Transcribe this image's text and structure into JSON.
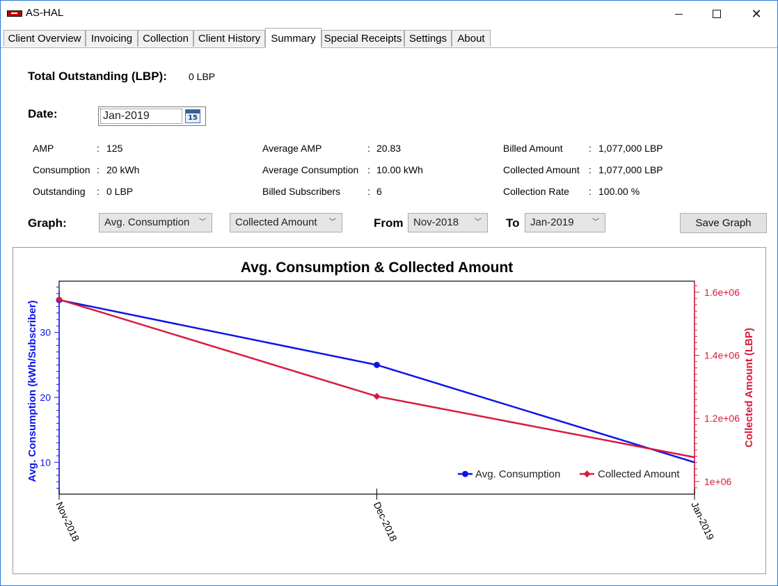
{
  "window": {
    "title": "AS-HAL"
  },
  "tabs": [
    {
      "label": "Client Overview"
    },
    {
      "label": "Invoicing"
    },
    {
      "label": "Collection"
    },
    {
      "label": "Client History"
    },
    {
      "label": "Summary"
    },
    {
      "label": "Special Receipts"
    },
    {
      "label": "Settings"
    },
    {
      "label": "About"
    }
  ],
  "summary": {
    "total_outstanding_label": "Total Outstanding (LBP):",
    "total_outstanding_value": "0 LBP",
    "date_label": "Date:",
    "date_value": "Jan-2019",
    "date_icon_text": "15",
    "stats": {
      "col1": [
        {
          "label": "AMP",
          "sep": ":",
          "value": "125"
        },
        {
          "label": "Consumption",
          "sep": ":",
          "value": "20 kWh"
        },
        {
          "label": "Outstanding",
          "sep": ":",
          "value": "0 LBP"
        }
      ],
      "col2": [
        {
          "label": "Average AMP",
          "sep": ":",
          "value": "20.83"
        },
        {
          "label": "Average Consumption",
          "sep": ":",
          "value": "10.00 kWh"
        },
        {
          "label": "Billed Subscribers",
          "sep": ":",
          "value": "6"
        }
      ],
      "col3": [
        {
          "label": "Billed Amount",
          "sep": ":",
          "value": "1,077,000 LBP"
        },
        {
          "label": "Collected Amount",
          "sep": ":",
          "value": "1,077,000 LBP"
        },
        {
          "label": "Collection Rate",
          "sep": ":",
          "value": "100.00 %"
        }
      ]
    },
    "graph_label": "Graph:",
    "graph_select_1": "Avg. Consumption",
    "graph_select_2": "Collected Amount",
    "from_label": "From",
    "from_value": "Nov-2018",
    "to_label": "To",
    "to_value": "Jan-2019",
    "save_button": "Save Graph"
  },
  "colors": {
    "series1": "#0b14e8",
    "series2": "#d81b3c",
    "accent": "#2b78d6"
  },
  "chart_data": {
    "type": "line",
    "title": "Avg. Consumption & Collected Amount",
    "categories": [
      "Nov-2018",
      "Dec-2018",
      "Jan-2019"
    ],
    "ylabel": "Avg. Consumption (kWh/Subscriber)",
    "y2label": "Collected Amount (LBP)",
    "ylim": [
      5.1,
      37.9
    ],
    "y2lim": [
      960000,
      1635000
    ],
    "yticks": [
      10,
      20,
      30
    ],
    "y2ticks": [
      1000000,
      1200000,
      1400000,
      1600000
    ],
    "y2tick_labels": [
      "1e+06",
      "1.2e+06",
      "1.4e+06",
      "1.6e+06"
    ],
    "legend_position": "bottom-right",
    "series": [
      {
        "name": "Avg. Consumption",
        "axis": "left",
        "marker": "circle",
        "values": [
          35.0,
          25.0,
          10.0
        ]
      },
      {
        "name": "Collected Amount",
        "axis": "right",
        "marker": "diamond",
        "values": [
          1577000,
          1270000,
          1077000
        ]
      }
    ]
  }
}
